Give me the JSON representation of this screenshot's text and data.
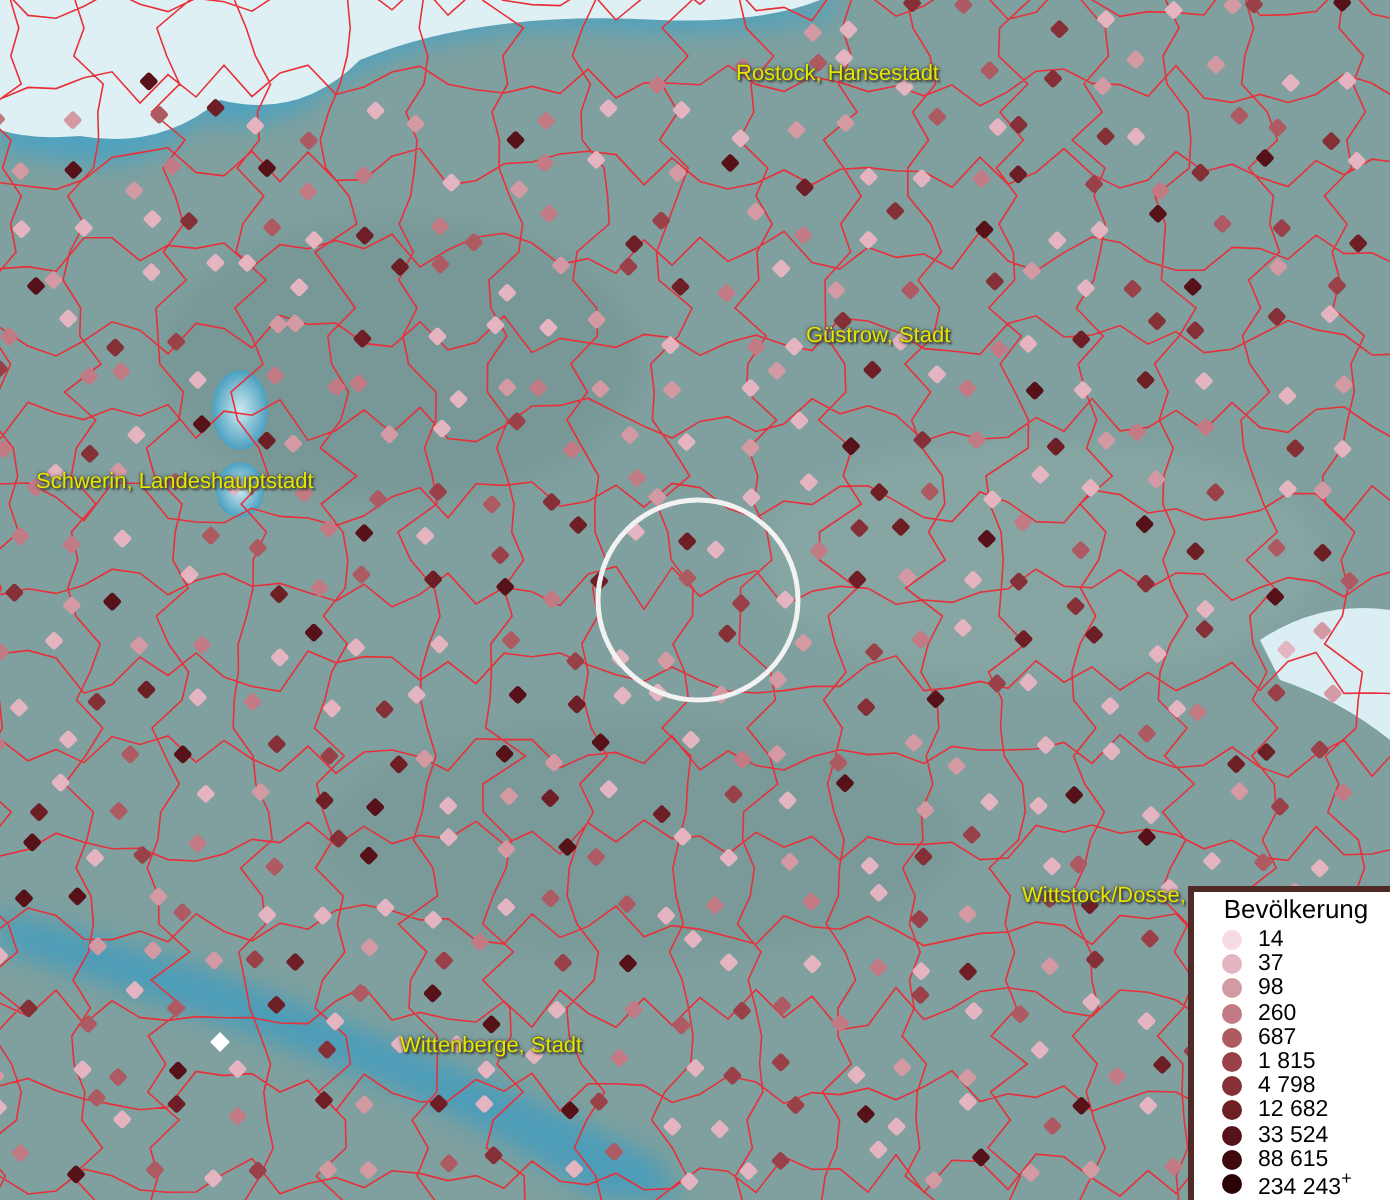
{
  "map": {
    "places": [
      {
        "name": "Rostock, Hansestadt"
      },
      {
        "name": "Güstrow, Stadt"
      },
      {
        "name": "Schwerin, Landeshauptstadt"
      },
      {
        "name": "Wittstock/Dosse,"
      },
      {
        "name": "Wittenberge, Stadt"
      }
    ]
  },
  "legend": {
    "title": "Bevölkerung",
    "items": [
      {
        "label": "14",
        "color": "#f6dbe6"
      },
      {
        "label": "37",
        "color": "#e4b5c0"
      },
      {
        "label": "98",
        "color": "#d49aa4"
      },
      {
        "label": "260",
        "color": "#c27a85"
      },
      {
        "label": "687",
        "color": "#ad5a63"
      },
      {
        "label": "1 815",
        "color": "#994048"
      },
      {
        "label": "4 798",
        "color": "#852f36"
      },
      {
        "label": "12 682",
        "color": "#6e1e25"
      },
      {
        "label": "33 524",
        "color": "#561218"
      },
      {
        "label": "88 615",
        "color": "#3f0a0e"
      },
      {
        "label": "234 243$^{+}$",
        "color": "#2a0406"
      }
    ]
  }
}
